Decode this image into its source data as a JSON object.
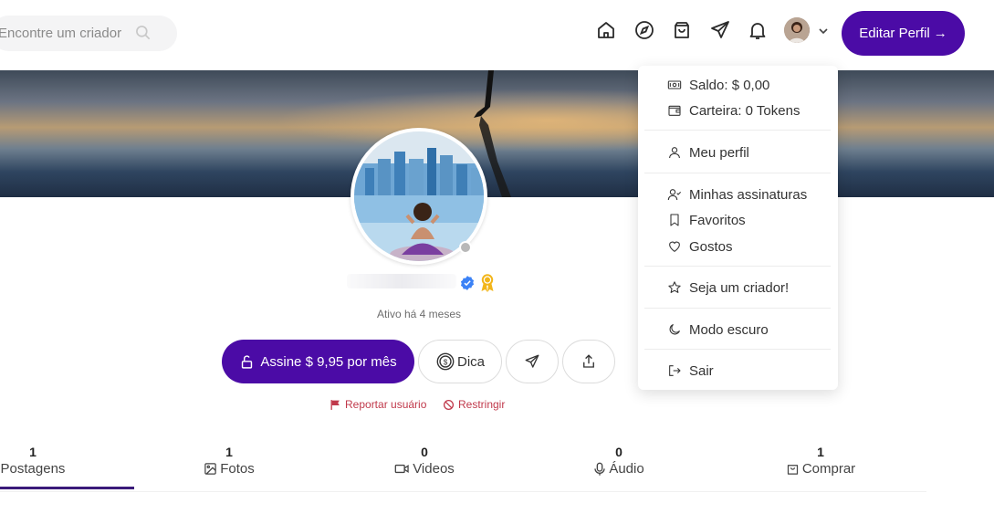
{
  "search": {
    "placeholder": "Encontre um criador"
  },
  "header": {
    "icons": [
      "home-icon",
      "compass-icon",
      "shopping-bag-icon",
      "send-icon",
      "bell-icon"
    ],
    "edit_profile_label": "Editar Perfil",
    "edit_profile_arrow": "→"
  },
  "profile": {
    "active_text": "Ativo há 4 meses",
    "subscribe_label": "Assine $ 9,95 por mês",
    "tip_label": "Dica",
    "report_label": "Reportar usuário",
    "restrict_label": "Restringir"
  },
  "tabs": [
    {
      "count": "1",
      "label": "Postagens"
    },
    {
      "count": "1",
      "label": "Fotos"
    },
    {
      "count": "0",
      "label": "Videos"
    },
    {
      "count": "0",
      "label": "Áudio"
    },
    {
      "count": "1",
      "label": "Comprar"
    }
  ],
  "dropdown": {
    "balance": "Saldo: $ 0,00",
    "wallet": "Carteira: 0 Tokens",
    "my_profile": "Meu perfil",
    "my_subscriptions": "Minhas assinaturas",
    "favorites": "Favoritos",
    "likes": "Gostos",
    "become_creator": "Seja um criador!",
    "dark_mode": "Modo escuro",
    "logout": "Sair"
  },
  "colors": {
    "accent": "#4b0ba6",
    "danger": "#c0394b",
    "verified": "#3b82f6",
    "award": "#f2b51a"
  }
}
